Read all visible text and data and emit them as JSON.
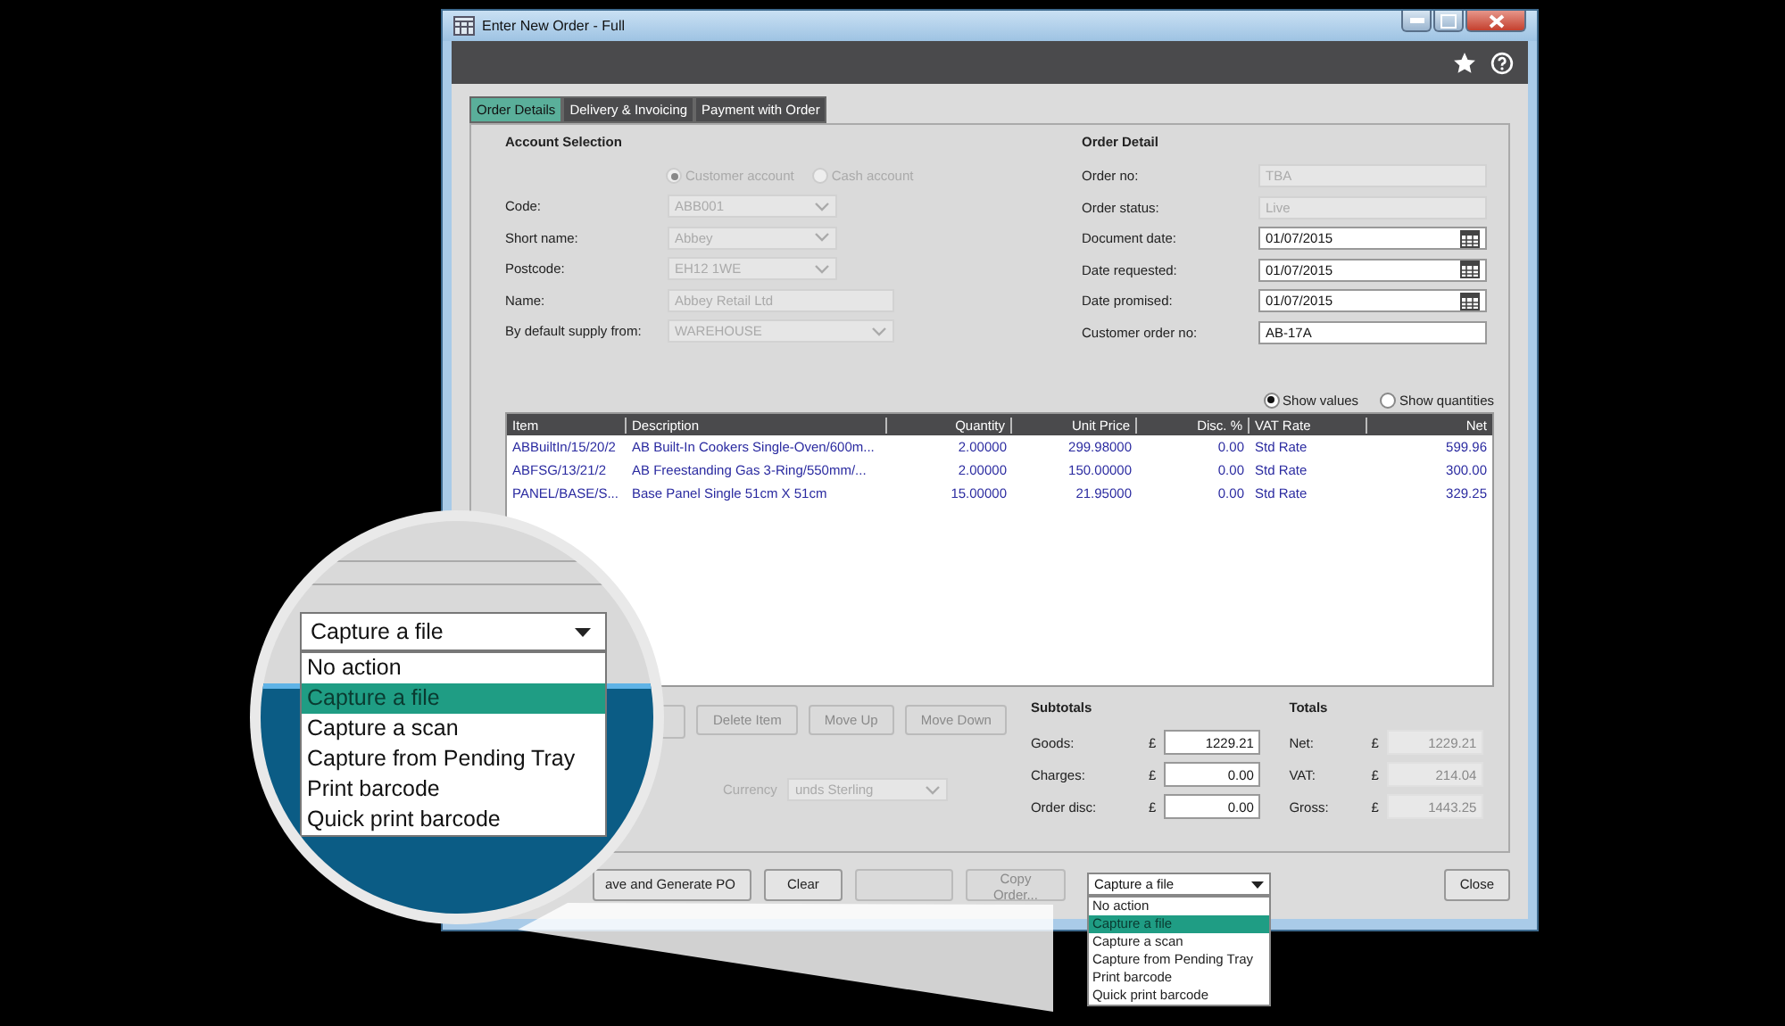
{
  "window": {
    "title": "Enter New Order - Full"
  },
  "tabs": [
    {
      "label": "Order Details",
      "selected": true
    },
    {
      "label": "Delivery & Invoicing",
      "selected": false
    },
    {
      "label": "Payment with Order",
      "selected": false
    }
  ],
  "account_selection": {
    "heading": "Account Selection",
    "disabled": true,
    "account_types": [
      {
        "label": "Customer account",
        "selected": true
      },
      {
        "label": "Cash account",
        "selected": false
      }
    ],
    "fields": [
      {
        "label": "Code:",
        "value": "ABB001",
        "kind": "dropdown"
      },
      {
        "label": "Short name:",
        "value": "Abbey",
        "kind": "dropdown"
      },
      {
        "label": "Postcode:",
        "value": "EH12 1WE",
        "kind": "dropdown"
      },
      {
        "label": "Name:",
        "value": "Abbey Retail Ltd",
        "kind": "wide"
      },
      {
        "label": "By default supply from:",
        "value": "WAREHOUSE",
        "kind": "wide-dropdown"
      }
    ]
  },
  "order_detail": {
    "heading": "Order Detail",
    "fields": [
      {
        "label": "Order no:",
        "value": "TBA",
        "kind": "readonly"
      },
      {
        "label": "Order status:",
        "value": "Live",
        "kind": "readonly"
      },
      {
        "label": "Document date:",
        "value": "01/07/2015",
        "kind": "date"
      },
      {
        "label": "Date requested:",
        "value": "01/07/2015",
        "kind": "date"
      },
      {
        "label": "Date promised:",
        "value": "01/07/2015",
        "kind": "date"
      },
      {
        "label": "Customer order no:",
        "value": "AB-17A",
        "kind": "text"
      }
    ]
  },
  "view_options": [
    {
      "label": "Show values",
      "selected": true
    },
    {
      "label": "Show quantities",
      "selected": false
    }
  ],
  "table": {
    "columns": [
      "Item",
      "Description",
      "Quantity",
      "Unit Price",
      "Disc. %",
      "VAT Rate",
      "Net"
    ],
    "rows": [
      [
        "ABBuiltIn/15/20/2",
        "AB Built-In Cookers Single-Oven/600m...",
        "2.00000",
        "299.98000",
        "0.00",
        "Std Rate",
        "599.96"
      ],
      [
        "ABFSG/13/21/2",
        "AB Freestanding Gas 3-Ring/550mm/...",
        "2.00000",
        "150.00000",
        "0.00",
        "Std Rate",
        "300.00"
      ],
      [
        "PANEL/BASE/S...",
        "Base Panel Single 51cm X 51cm",
        "15.00000",
        "21.95000",
        "0.00",
        "Std Rate",
        "329.25"
      ]
    ]
  },
  "item_buttons": [
    {
      "label": "Delete Item",
      "disabled": true
    },
    {
      "label": "Move Up",
      "disabled": true
    },
    {
      "label": "Move Down",
      "disabled": true
    }
  ],
  "currency": {
    "label": "Currency",
    "value": "unds Sterling",
    "disabled": true
  },
  "subtotals": {
    "heading": "Subtotals",
    "rows": [
      {
        "label": "Goods:",
        "symbol": "£",
        "value": "1229.21",
        "editable": true
      },
      {
        "label": "Charges:",
        "symbol": "£",
        "value": "0.00",
        "editable": true
      },
      {
        "label": "Order disc:",
        "symbol": "£",
        "value": "0.00",
        "editable": true
      }
    ]
  },
  "totals": {
    "heading": "Totals",
    "rows": [
      {
        "label": "Net:",
        "symbol": "£",
        "value": "1229.21",
        "editable": false
      },
      {
        "label": "VAT:",
        "symbol": "£",
        "value": "214.04",
        "editable": false
      },
      {
        "label": "Gross:",
        "symbol": "£",
        "value": "1443.25",
        "editable": false
      }
    ]
  },
  "footer_buttons": [
    {
      "label": "ave and Generate PO",
      "disabled": false
    },
    {
      "label": "Clear",
      "disabled": false
    },
    {
      "disabled": true
    },
    {
      "label": "Copy Order...",
      "disabled": true
    }
  ],
  "capture_action": {
    "value": "Capture a file",
    "options": [
      {
        "label": "No action",
        "selected": false
      },
      {
        "label": "Capture a file",
        "selected": true
      },
      {
        "label": "Capture a scan",
        "selected": false
      },
      {
        "label": "Capture from Pending Tray",
        "selected": false
      },
      {
        "label": "Print barcode",
        "selected": false
      },
      {
        "label": "Quick print barcode",
        "selected": false
      }
    ]
  },
  "close_button": "Close",
  "magnifier": {
    "value": "Capture a file",
    "options": [
      {
        "label": "No action",
        "selected": false
      },
      {
        "label": "Capture a file",
        "selected": true
      },
      {
        "label": "Capture a scan",
        "selected": false
      },
      {
        "label": "Capture from Pending Tray",
        "selected": false
      },
      {
        "label": "Print barcode",
        "selected": false
      },
      {
        "label": "Quick print barcode",
        "selected": false
      }
    ]
  }
}
